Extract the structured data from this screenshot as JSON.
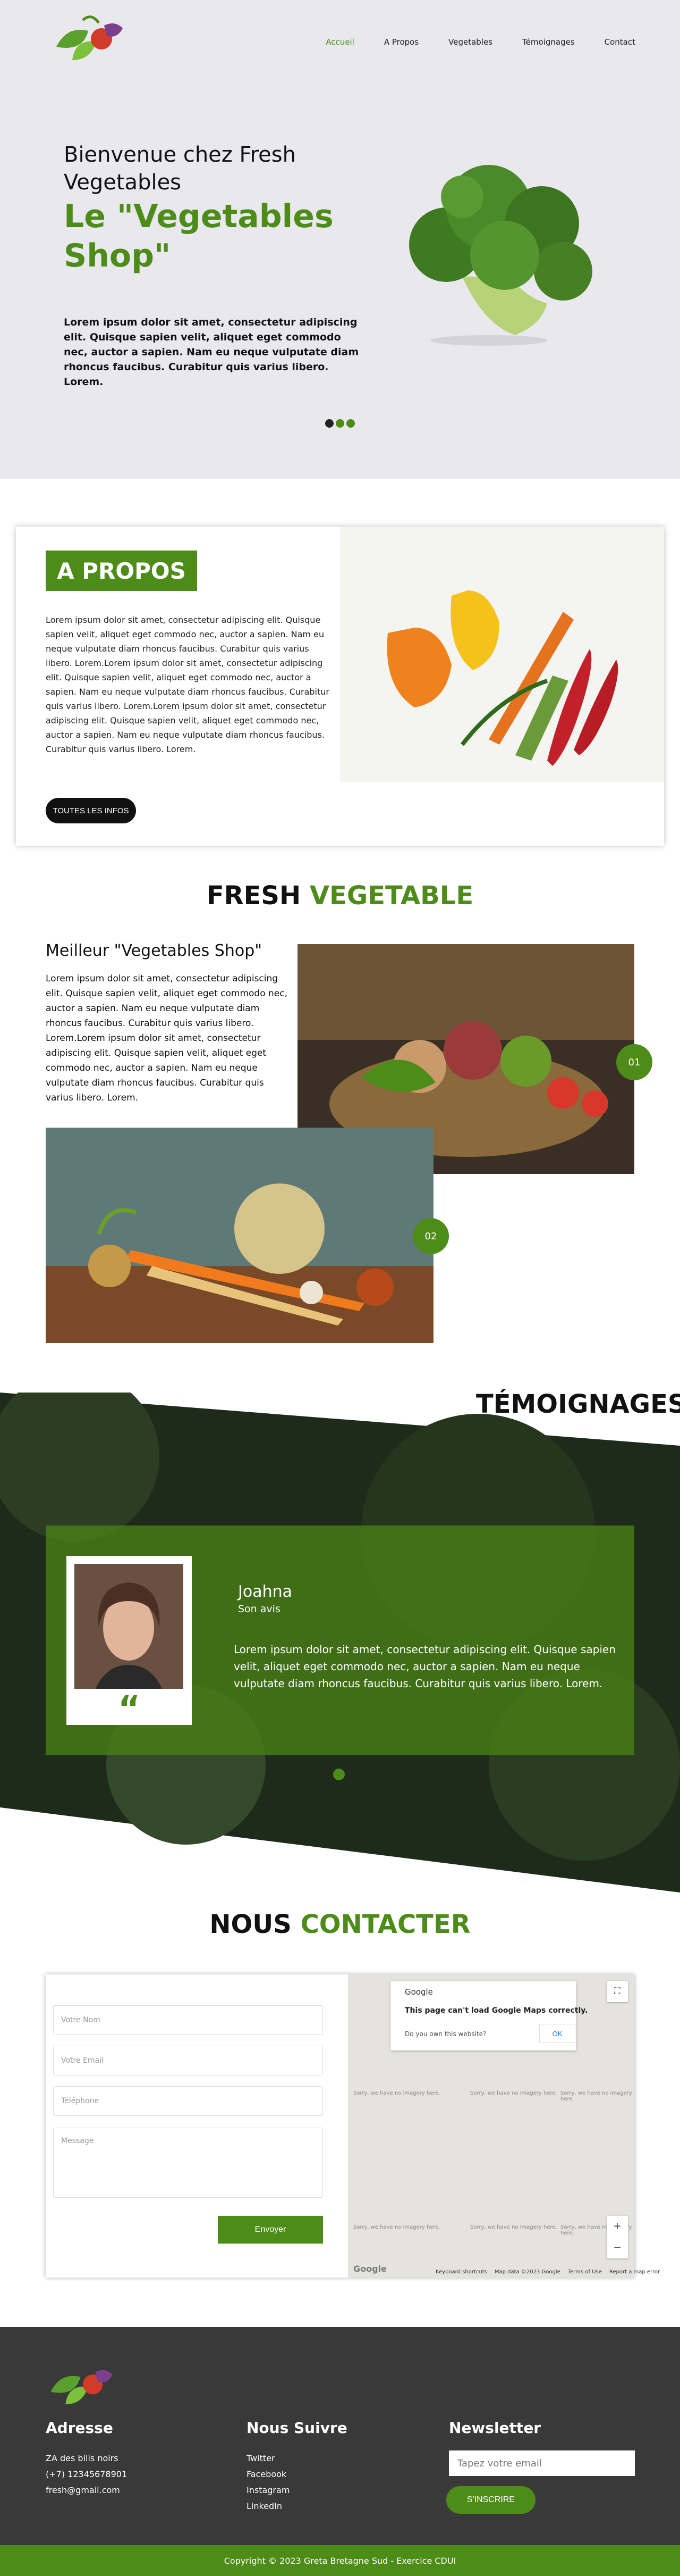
{
  "nav": {
    "items": [
      {
        "label": "Accueil",
        "active": true
      },
      {
        "label": "A Propos",
        "active": false
      },
      {
        "label": "Vegetables",
        "active": false
      },
      {
        "label": "Témoignages",
        "active": false
      },
      {
        "label": "Contact",
        "active": false
      }
    ]
  },
  "hero": {
    "welcome": "Bienvenue chez Fresh Vegetables",
    "title": "Le \"Vegetables Shop\"",
    "text": "Lorem ipsum dolor sit amet, consectetur adipiscing elit. Quisque sapien velit, aliquet eget commodo nec, auctor a sapien. Nam eu neque vulputate diam rhoncus faucibus. Curabitur quis varius libero. Lorem.",
    "slides": 3,
    "active_slide": 1
  },
  "about": {
    "title": "A PROPOS",
    "text": "Lorem ipsum dolor sit amet, consectetur adipiscing elit. Quisque sapien velit, aliquet eget commodo nec, auctor a sapien. Nam eu neque vulputate diam rhoncus faucibus. Curabitur quis varius libero. Lorem.Lorem ipsum dolor sit amet, consectetur adipiscing elit. Quisque sapien velit, aliquet eget commodo nec, auctor a sapien. Nam eu neque vulputate diam rhoncus faucibus. Curabitur quis varius libero. Lorem.Lorem ipsum dolor sit amet, consectetur adipiscing elit. Quisque sapien velit, aliquet eget commodo nec, auctor a sapien. Nam eu neque vulputate diam rhoncus faucibus. Curabitur quis varius libero. Lorem.",
    "button": "TOUTES LES INFOS"
  },
  "fresh": {
    "title_dark": "FRESH",
    "title_green": "VEGETABLE",
    "subtitle": "Meilleur \"Vegetables Shop\"",
    "text": "Lorem ipsum dolor sit amet, consectetur adipiscing elit. Quisque sapien velit, aliquet eget commodo nec, auctor a sapien. Nam eu neque vulputate diam rhoncus faucibus. Curabitur quis varius libero. Lorem.Lorem ipsum dolor sit amet, consectetur adipiscing elit. Quisque sapien velit, aliquet eget commodo nec, auctor a sapien. Nam eu neque vulputate diam rhoncus faucibus. Curabitur quis varius libero. Lorem.",
    "badge1": "01",
    "badge2": "02"
  },
  "testimonials": {
    "title": "TÉMOIGNAGES",
    "name": "Joahna",
    "role": "Son avis",
    "quote_mark": "“",
    "text": "Lorem ipsum dolor sit amet, consectetur adipiscing elit. Quisque sapien velit, aliquet eget commodo nec, auctor a sapien. Nam eu neque vulputate diam rhoncus faucibus. Curabitur quis varius libero. Lorem."
  },
  "contact": {
    "title_dark": "NOUS",
    "title_green": "CONTACTER",
    "name_placeholder": "Votre Nom",
    "email_placeholder": "Votre Email",
    "phone_placeholder": "Téléphone",
    "message_placeholder": "Message",
    "send": "Envoyer"
  },
  "map": {
    "google": "Google",
    "error": "This page can't load Google Maps correctly.",
    "question": "Do you own this website?",
    "ok": "OK",
    "dev_text": "Sorry, we have no imagery here.",
    "logo": "Google",
    "footer": [
      "Keyboard shortcuts",
      "Map data ©2023 Google",
      "Terms of Use",
      "Report a map error"
    ],
    "zoom_in": "+",
    "zoom_out": "−"
  },
  "footer": {
    "address_title": "Adresse",
    "address_lines": [
      "ZA des bilis noirs",
      "(+7) 12345678901",
      "fresh@gmail.com"
    ],
    "follow_title": "Nous Suivre",
    "follow_links": [
      "Twitter",
      "Facebook",
      "Instagram",
      "LinkedIn"
    ],
    "newsletter_title": "Newsletter",
    "newsletter_placeholder": "Tapez votre email",
    "subscribe": "S'INSCRIRE",
    "copyright": "Copyright © 2023 Greta Bretagne Sud - Exercice CDUI"
  },
  "colors": {
    "accent": "#4e8c1a",
    "dark": "#393939",
    "hero_bg": "#e9e9ed"
  }
}
